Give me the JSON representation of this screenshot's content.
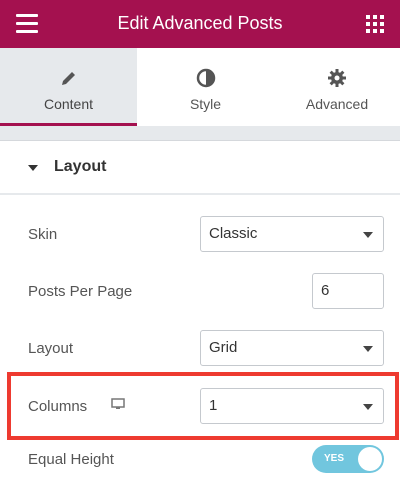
{
  "header": {
    "title": "Edit Advanced Posts",
    "menu_icon": "hamburger-icon",
    "apps_icon": "grid-icon",
    "color": "#a4114f"
  },
  "tabs": [
    {
      "label": "Content",
      "icon": "pencil-icon",
      "active": true
    },
    {
      "label": "Style",
      "icon": "half-circle-icon",
      "active": false
    },
    {
      "label": "Advanced",
      "icon": "gear-icon",
      "active": false
    }
  ],
  "section": {
    "title": "Layout",
    "caret_icon": "caret-down-icon"
  },
  "controls": {
    "skin": {
      "label": "Skin",
      "value": "Classic"
    },
    "posts_per_page": {
      "label": "Posts Per Page",
      "value": "6"
    },
    "layout": {
      "label": "Layout",
      "value": "Grid"
    },
    "columns": {
      "label": "Columns",
      "value": "1",
      "device_icon": "monitor-icon",
      "highlight_color": "#ee3a30"
    },
    "equal_height": {
      "label": "Equal Height",
      "toggle_text": "YES",
      "on": true,
      "toggle_color": "#71c6de"
    }
  }
}
